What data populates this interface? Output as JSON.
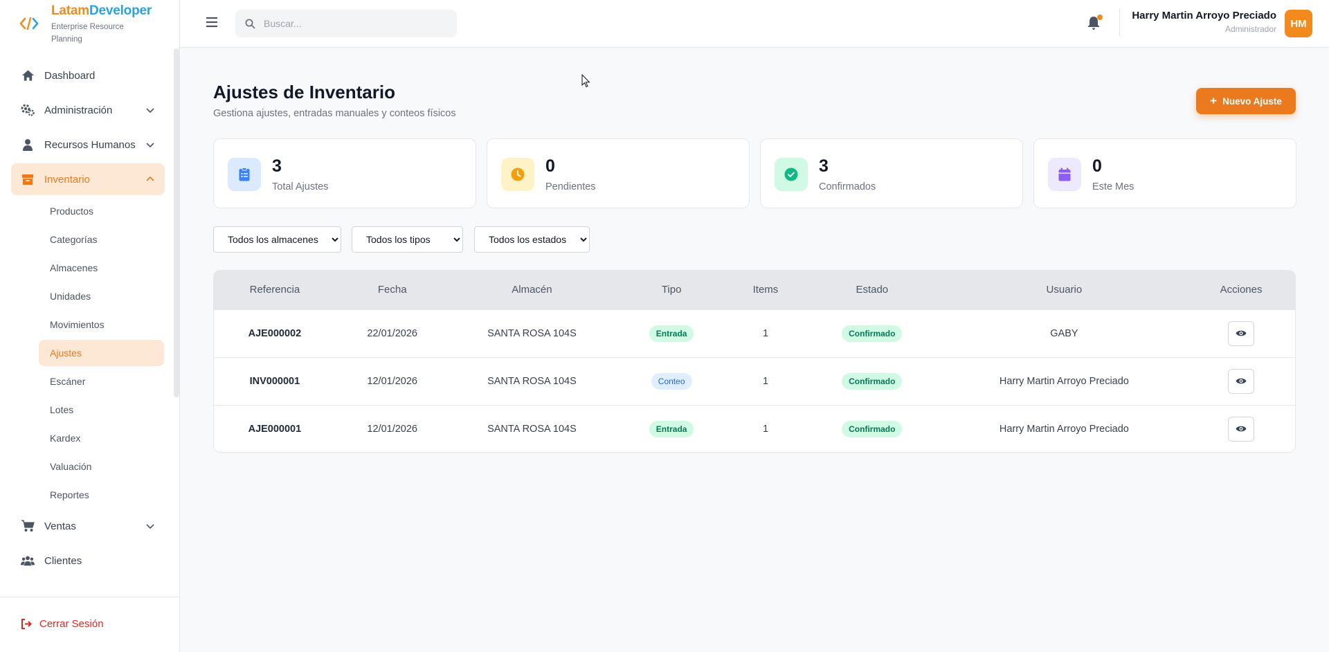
{
  "brand": {
    "name_part1": "Latam",
    "name_part2": "Developer",
    "subtitle": "Enterprise Resource Planning"
  },
  "colors": {
    "accent": "#ea7a1d",
    "brand_blue": "#25a3e3",
    "danger": "#dc2626",
    "success_bg": "#d1fae5",
    "success_fg": "#047857"
  },
  "sidebar": {
    "items": [
      {
        "label": "Dashboard",
        "icon": "home-icon"
      },
      {
        "label": "Administración",
        "icon": "gears-icon"
      },
      {
        "label": "Recursos Humanos",
        "icon": "user-tie-icon"
      },
      {
        "label": "Inventario",
        "icon": "box-icon"
      }
    ],
    "inventario_sub": [
      "Productos",
      "Categorías",
      "Almacenes",
      "Unidades",
      "Movimientos",
      "Ajustes",
      "Escáner",
      "Lotes",
      "Kardex",
      "Valuación",
      "Reportes"
    ],
    "items_after": [
      {
        "label": "Ventas",
        "icon": "cart-icon"
      },
      {
        "label": "Clientes",
        "icon": "users-icon"
      }
    ],
    "logout_label": "Cerrar Sesión"
  },
  "topbar": {
    "search_placeholder": "Buscar...",
    "user_name": "Harry Martin Arroyo Preciado",
    "user_role": "Administrador",
    "avatar_initials": "HM"
  },
  "main": {
    "title": "Ajustes de Inventario",
    "subtitle": "Gestiona ajustes, entradas manuales y conteos físicos",
    "new_button": "Nuevo Ajuste",
    "new_button_icon": "+",
    "stats": [
      {
        "value": "3",
        "label": "Total Ajustes",
        "icon": "clipboard-list-icon",
        "color": "#3b82f6",
        "bg": "#dbeafe"
      },
      {
        "value": "0",
        "label": "Pendientes",
        "icon": "clock-icon",
        "color": "#f59e0b",
        "bg": "#fef3c7"
      },
      {
        "value": "3",
        "label": "Confirmados",
        "icon": "check-circle-icon",
        "color": "#10b981",
        "bg": "#d1fae5"
      },
      {
        "value": "0",
        "label": "Este Mes",
        "icon": "calendar-icon",
        "color": "#8b5cf6",
        "bg": "#ede9fe"
      }
    ],
    "filters": {
      "almacen": "Todos los almacenes",
      "tipo": "Todos los tipos",
      "estado": "Todos los estados"
    },
    "table": {
      "headers": [
        "Referencia",
        "Fecha",
        "Almacén",
        "Tipo",
        "Items",
        "Estado",
        "Usuario",
        "Acciones"
      ],
      "rows": [
        {
          "ref": "AJE000002",
          "fecha": "22/01/2026",
          "almacen": "SANTA ROSA 104S",
          "tipo": "Entrada",
          "items": "1",
          "estado": "Confirmado",
          "usuario": "GABY"
        },
        {
          "ref": "INV000001",
          "fecha": "12/01/2026",
          "almacen": "SANTA ROSA 104S",
          "tipo": "Conteo",
          "items": "1",
          "estado": "Confirmado",
          "usuario": "Harry Martin Arroyo Preciado"
        },
        {
          "ref": "AJE000001",
          "fecha": "12/01/2026",
          "almacen": "SANTA ROSA 104S",
          "tipo": "Entrada",
          "items": "1",
          "estado": "Confirmado",
          "usuario": "Harry Martin Arroyo Preciado"
        }
      ]
    }
  }
}
